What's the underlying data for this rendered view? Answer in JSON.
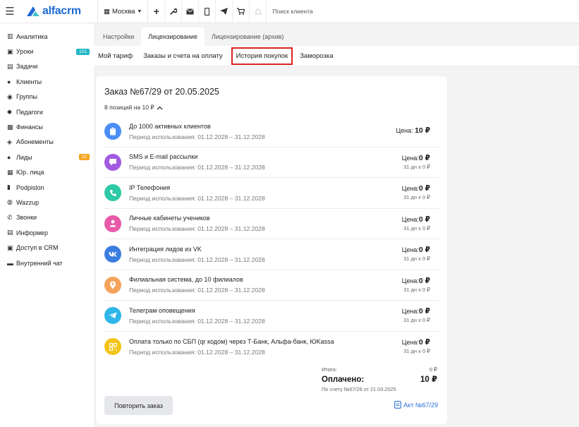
{
  "header": {
    "logo_text": "alfacrm",
    "city": "Москва",
    "search_placeholder": "Поиск клиента"
  },
  "sidebar": {
    "items": [
      {
        "label": "Аналитика",
        "icon": "chart-icon"
      },
      {
        "label": "Уроки",
        "icon": "calendar-icon",
        "badge": "101",
        "badge_color": "#22b7c5"
      },
      {
        "label": "Задачи",
        "icon": "tasks-icon"
      },
      {
        "label": "Клиенты",
        "icon": "user-icon"
      },
      {
        "label": "Группы",
        "icon": "group-icon"
      },
      {
        "label": "Педагоги",
        "icon": "graduation-cap-icon"
      },
      {
        "label": "Финансы",
        "icon": "money-icon"
      },
      {
        "label": "Абонементы",
        "icon": "tag-icon"
      },
      {
        "label": "Лиды",
        "icon": "lead-icon",
        "badge": "22",
        "badge_color": "#f6a623"
      },
      {
        "label": "Юр. лица",
        "icon": "bank-icon"
      },
      {
        "label": "Podpislon",
        "icon": "document-icon"
      },
      {
        "label": "Wazzup",
        "icon": "whatsapp-icon"
      },
      {
        "label": "Звонки",
        "icon": "phone-icon"
      },
      {
        "label": "Информер",
        "icon": "informer-icon"
      },
      {
        "label": "Доступ в CRM",
        "icon": "lock-icon"
      },
      {
        "label": "Внутренний чат",
        "icon": "chat-icon"
      }
    ]
  },
  "tabs": {
    "primary": [
      "Настройки",
      "Лицензирование",
      "Лицензирование (архив)"
    ],
    "secondary": [
      "Мой тариф",
      "Заказы и счета на оплату",
      "История покупок",
      "Заморозка"
    ]
  },
  "order": {
    "title_prefix": "Заказ №67/29",
    "title_suffix": "от 20.05.2025",
    "positions": "8 позиций на 10 ₽",
    "items": [
      {
        "name": "До 1000 активных клиентов",
        "period": "Период использования: 01.12.2028 – 31.12.2028",
        "price_label": "Цена:",
        "price": "10 ₽",
        "sub": "",
        "color": "#4c8ef7",
        "icon": "clipboard-icon"
      },
      {
        "name": "SMS и E-mail рассылки",
        "period": "Период использования: 01.12.2028 – 31.12.2028",
        "price_label": "Цена:",
        "price": "0 ₽",
        "sub": "31 дн x 0 ₽",
        "color": "#a25be0",
        "icon": "sms-icon"
      },
      {
        "name": "IP Телефония",
        "period": "Период использования: 01.12.2028 – 31.12.2028",
        "price_label": "Цена:",
        "price": "0 ₽",
        "sub": "31 дн x 0 ₽",
        "color": "#2ec9a6",
        "icon": "phone-icon"
      },
      {
        "name": "Личные кабинеты учеников",
        "period": "Период использования: 01.12.2028 – 31.12.2028",
        "price_label": "Цена:",
        "price": "0 ₽",
        "sub": "31 дн x 0 ₽",
        "color": "#e85ba9",
        "icon": "student-icon"
      },
      {
        "name": "Интеграция лидов из VK",
        "period": "Период использования: 01.12.2028 – 31.12.2028",
        "price_label": "Цена:",
        "price": "0 ₽",
        "sub": "31 дн x 0 ₽",
        "color": "#3a7de0",
        "icon": "vk-icon"
      },
      {
        "name": "Филиальная система, до 10 филиалов",
        "period": "Период использования: 01.12.2028 – 31.12.2028",
        "price_label": "Цена:",
        "price": "0 ₽",
        "sub": "31 дн x 0 ₽",
        "color": "#f5a35c",
        "icon": "branch-icon"
      },
      {
        "name": "Телеграм оповещения",
        "period": "Период использования: 01.12.2028 – 31.12.2028",
        "price_label": "Цена:",
        "price": "0 ₽",
        "sub": "31 дн x 0 ₽",
        "color": "#2fb6e8",
        "icon": "telegram-icon"
      },
      {
        "name": "Оплата только по СБП (qr кодом) через Т-Банк, Альфа-банк, ЮKassa",
        "period": "Период использования: 01.12.2028 – 31.12.2028",
        "price_label": "Цена:",
        "price": "0 ₽",
        "sub": "31 дн x 0 ₽",
        "color": "#f3c316",
        "icon": "qr-icon"
      }
    ],
    "total_label": "Итого:",
    "total_value": "0 ₽",
    "paid_label": "Оплачено:",
    "paid_value": "10 ₽",
    "invoice_note": "По счету №67/29 от 21.03.2025",
    "repeat_button": "Повторить заказ",
    "act_link": "Акт №67/29"
  }
}
